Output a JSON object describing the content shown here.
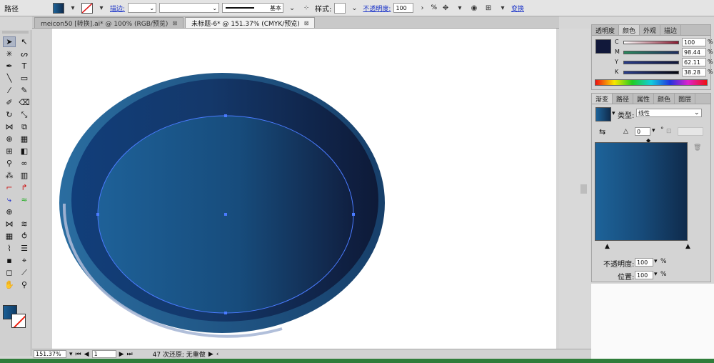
{
  "control_bar": {
    "object_type": "路径",
    "stroke_link": "描边:",
    "stroke_weight": "",
    "brush_preset": "基本",
    "style_label": "样式:",
    "opacity_link": "不透明度:",
    "opacity_value": "100",
    "opacity_unit": "%",
    "transform_link": "变换",
    "fill_color": "#174b7a"
  },
  "doc_tabs": [
    {
      "label": "meicon50 [转换].ai* @ 100% (RGB/预览)",
      "close": "⊠"
    },
    {
      "label": "未标题-6* @ 151.37% (CMYK/预览)",
      "close": "⊠"
    }
  ],
  "status_bar": {
    "zoom": "151.37%",
    "artboard": "1",
    "info": "47 次还原; 无重做"
  },
  "color_panel": {
    "tabs": [
      "透明度",
      "颜色",
      "外观",
      "描边"
    ],
    "active_tab": "颜色",
    "channels": [
      {
        "key": "C",
        "value": "100",
        "unit": "%"
      },
      {
        "key": "M",
        "value": "98.44",
        "unit": "%"
      },
      {
        "key": "Y",
        "value": "62.11",
        "unit": "%"
      },
      {
        "key": "K",
        "value": "38.28",
        "unit": "%"
      }
    ],
    "swatch_color": "#11183a"
  },
  "gradient_panel": {
    "tabs": [
      "渐变",
      "路径",
      "属性",
      "颜色",
      "图层"
    ],
    "active_tab": "渐变",
    "type_label": "类型:",
    "type_value": "线性",
    "angle_value": "0",
    "angle_unit": "°",
    "opacity_label": "不透明度:",
    "opacity_value": "100",
    "opacity_unit": "%",
    "position_label": "位置:",
    "position_value": "100",
    "position_unit": "%",
    "colors": [
      "#1d6399",
      "#0f2b4c"
    ]
  },
  "artwork": {
    "outer_ring_color": "#1f5f8d",
    "inner_gradient_start": "#1e5f93",
    "inner_gradient_end": "#0f1f3e",
    "selection_color": "#4a7bff"
  }
}
